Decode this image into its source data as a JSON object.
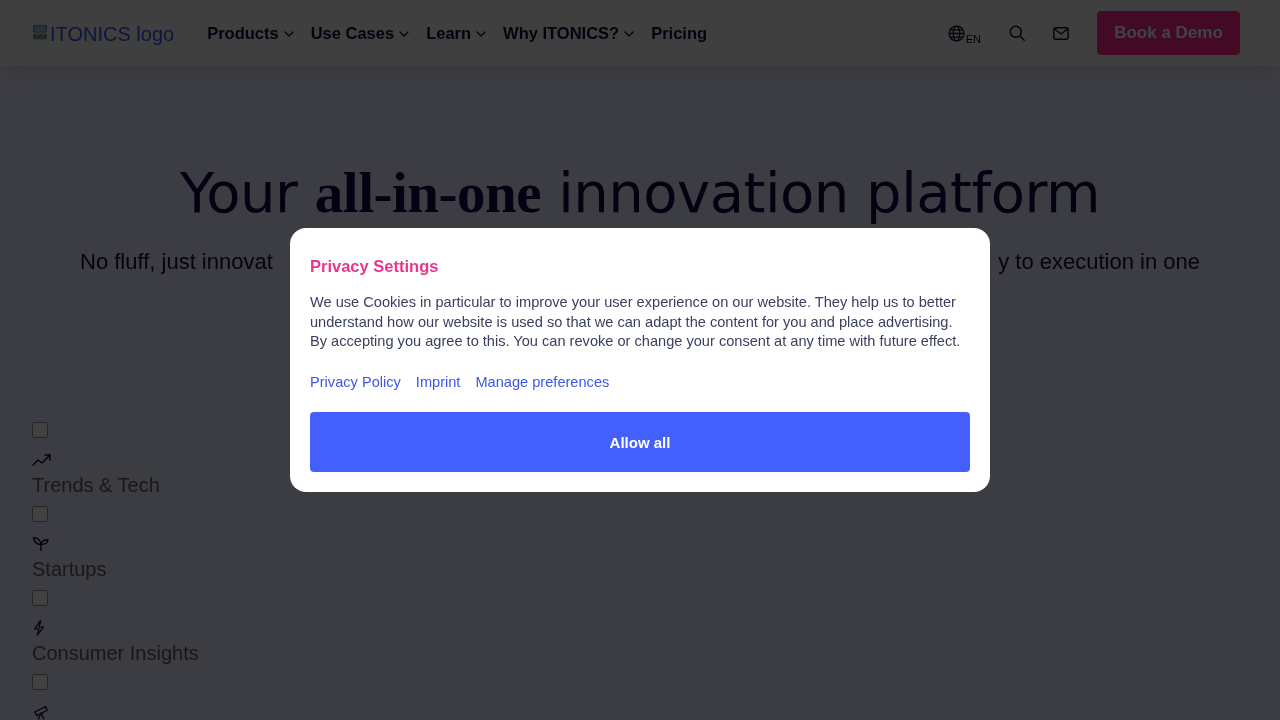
{
  "header": {
    "logo_alt_text": "ITONICS logo",
    "nav": [
      {
        "label": "Products",
        "has_dropdown": true
      },
      {
        "label": "Use Cases",
        "has_dropdown": true
      },
      {
        "label": "Learn",
        "has_dropdown": true
      },
      {
        "label": "Why ITONICS?",
        "has_dropdown": true
      },
      {
        "label": "Pricing",
        "has_dropdown": false
      }
    ],
    "language": "EN",
    "cta_button": "Book a Demo"
  },
  "hero": {
    "title": "Your **all-in-one** innovation platform",
    "subtitle_visible_parts": [
      "No fluff, just innovat",
      "y to execution in one"
    ]
  },
  "filters": [
    {
      "checked": false,
      "label": "Trends & Tech"
    },
    {
      "checked": false,
      "label": "Startups"
    },
    {
      "checked": false,
      "label": "Consumer Insights"
    },
    {
      "checked": false
    }
  ],
  "cookie_dialog": {
    "title": "Privacy Settings",
    "text": "We use Cookies in particular to improve your user experience on our website. They help us to better understand how our website is used so that we can adapt the content for you and place advertising. By accepting you agree to this. You can revoke or change your consent at any time with future effect.",
    "links": [
      "Privacy Policy",
      "Imprint",
      "Manage preferences"
    ],
    "button": "Allow all"
  }
}
